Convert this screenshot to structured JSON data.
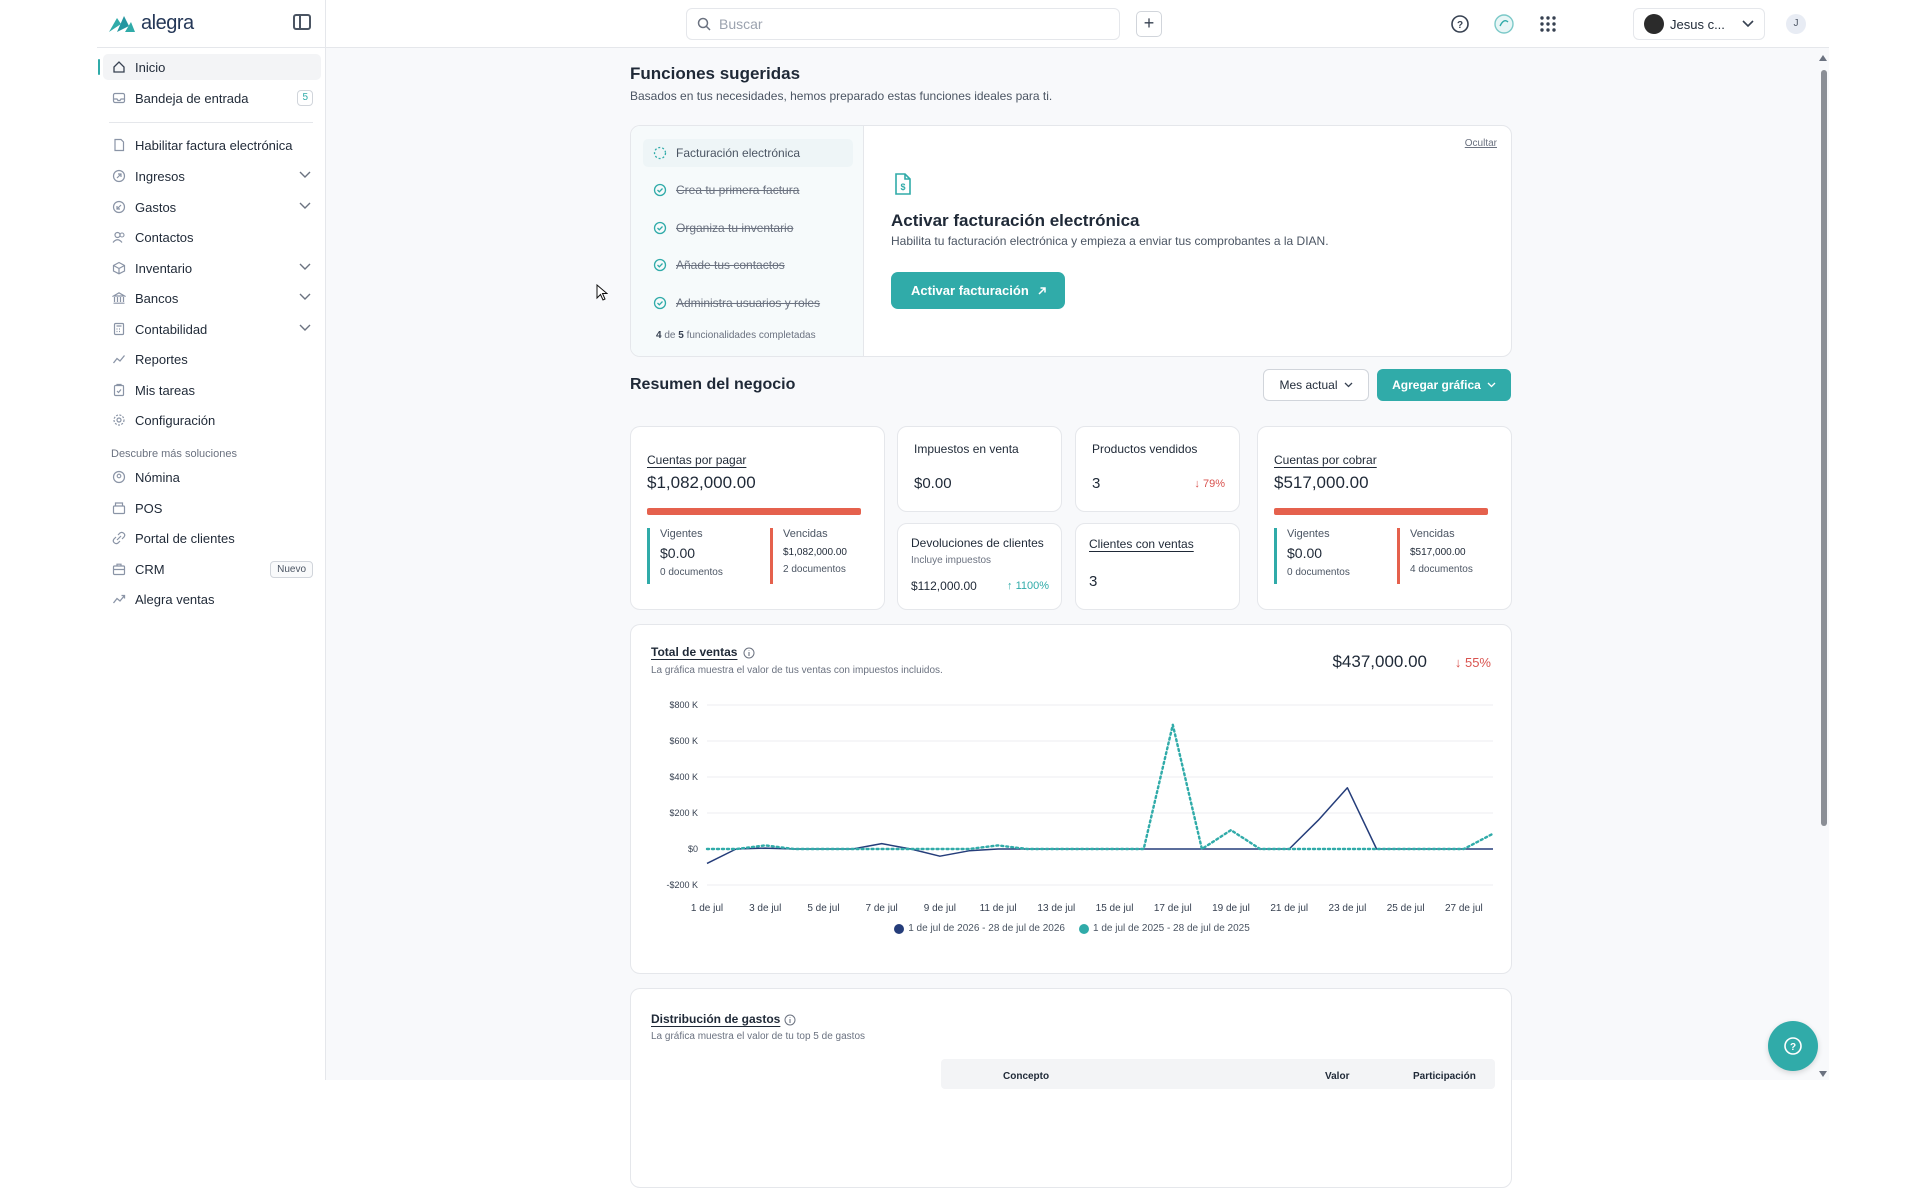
{
  "topbar": {
    "logo_text": "alegra",
    "search_placeholder": "Buscar",
    "add_label": "+",
    "user_name": "Jesus c...",
    "user_initial": "J"
  },
  "sidebar": {
    "items": [
      {
        "label": "Inicio",
        "icon": "home-icon"
      },
      {
        "label": "Bandeja de entrada",
        "icon": "inbox-icon",
        "badge": "5"
      },
      {
        "label": "Habilitar factura electrónica",
        "icon": "document-icon"
      },
      {
        "label": "Ingresos",
        "icon": "income-icon"
      },
      {
        "label": "Gastos",
        "icon": "expenses-icon"
      },
      {
        "label": "Contactos",
        "icon": "contacts-icon"
      },
      {
        "label": "Inventario",
        "icon": "box-icon"
      },
      {
        "label": "Bancos",
        "icon": "bank-icon"
      },
      {
        "label": "Contabilidad",
        "icon": "calculator-icon"
      },
      {
        "label": "Reportes",
        "icon": "chart-line-icon"
      },
      {
        "label": "Mis tareas",
        "icon": "clipboard-icon"
      },
      {
        "label": "Configuración",
        "icon": "gear-icon"
      }
    ],
    "section_label": "Descubre más soluciones",
    "solutions": [
      {
        "label": "Nómina",
        "icon": "payroll-icon"
      },
      {
        "label": "POS",
        "icon": "pos-icon"
      },
      {
        "label": "Portal de clientes",
        "icon": "portal-icon"
      },
      {
        "label": "CRM",
        "icon": "crm-icon",
        "badge": "Nuevo"
      },
      {
        "label": "Alegra ventas",
        "icon": "sales-icon"
      }
    ]
  },
  "suggested": {
    "title": "Funciones sugeridas",
    "subtitle": "Basados en tus necesidades, hemos preparado estas funciones ideales para ti.",
    "steps": [
      {
        "label": "Facturación electrónica",
        "done": false
      },
      {
        "label": "Crea tu primera factura",
        "done": true
      },
      {
        "label": "Organiza tu inventario",
        "done": true
      },
      {
        "label": "Añade tus contactos",
        "done": true
      },
      {
        "label": "Administra usuarios y roles",
        "done": true
      }
    ],
    "progress_done": "4",
    "progress_mid": "de",
    "progress_total": "5",
    "progress_suffix": "funcionalidades completadas",
    "hide_label": "Ocultar",
    "card_title": "Activar facturación electrónica",
    "card_desc": "Habilita tu facturación electrónica y empieza a enviar tus comprobantes a la DIAN.",
    "card_button": "Activar facturación"
  },
  "summary": {
    "title": "Resumen del negocio",
    "period_button": "Mes actual",
    "add_chart_button": "Agregar gráfica",
    "payables": {
      "title": "Cuentas por pagar",
      "value": "$1,082,000.00",
      "current_label": "Vigentes",
      "current_value": "$0.00",
      "current_docs": "0 documentos",
      "overdue_label": "Vencidas",
      "overdue_value": "$1,082,000.00",
      "overdue_docs": "2 documentos"
    },
    "sales_tax": {
      "title": "Impuestos en venta",
      "value": "$0.00"
    },
    "products_sold": {
      "title": "Productos vendidos",
      "value": "3",
      "trend": "79%"
    },
    "returns": {
      "title": "Devoluciones de clientes",
      "subtitle": "Incluye impuestos",
      "value": "$112,000.00",
      "trend": "1100%"
    },
    "clients_with_sales": {
      "title": "Clientes con ventas",
      "value": "3"
    },
    "receivables": {
      "title": "Cuentas por cobrar",
      "value": "$517,000.00",
      "current_label": "Vigentes",
      "current_value": "$0.00",
      "current_docs": "0 documentos",
      "overdue_label": "Vencidas",
      "overdue_value": "$517,000.00",
      "overdue_docs": "4 documentos"
    }
  },
  "sales_chart": {
    "title": "Total de ventas",
    "subtitle": "La gráfica muestra el valor de tus ventas con impuestos incluidos.",
    "total": "$437,000.00",
    "trend": "55%"
  },
  "chart_data": {
    "type": "line",
    "x": [
      "1 de jul",
      "2 de jul",
      "3 de jul",
      "4 de jul",
      "5 de jul",
      "6 de jul",
      "7 de jul",
      "8 de jul",
      "9 de jul",
      "10 de jul",
      "11 de jul",
      "12 de jul",
      "13 de jul",
      "14 de jul",
      "15 de jul",
      "16 de jul",
      "17 de jul",
      "18 de jul",
      "19 de jul",
      "20 de jul",
      "21 de jul",
      "22 de jul",
      "23 de jul",
      "24 de jul",
      "25 de jul",
      "26 de jul",
      "27 de jul",
      "28 de jul"
    ],
    "x_tick_labels": [
      "1 de jul",
      "3 de jul",
      "5 de jul",
      "7 de jul",
      "9 de jul",
      "11 de jul",
      "13 de jul",
      "15 de jul",
      "17 de jul",
      "19 de jul",
      "21 de jul",
      "23 de jul",
      "25 de jul",
      "27 de jul"
    ],
    "y_tick_labels": [
      "$800 K",
      "$600 K",
      "$400 K",
      "$200 K",
      "$0",
      "-$200 K"
    ],
    "ylim": [
      -200,
      800
    ],
    "y_unit": "K",
    "series": [
      {
        "name": "1 de jul de 2026 - 28 de jul de 2026",
        "color": "#253d7a",
        "style": "solid",
        "values": [
          -80,
          0,
          5,
          0,
          0,
          0,
          30,
          0,
          -40,
          -10,
          0,
          0,
          0,
          0,
          0,
          0,
          0,
          0,
          0,
          0,
          0,
          160,
          340,
          0,
          0,
          0,
          0,
          0
        ]
      },
      {
        "name": "1 de jul de 2025 - 28 de jul de 2025",
        "color": "#30aba9",
        "style": "dotted",
        "values": [
          0,
          0,
          20,
          0,
          0,
          0,
          0,
          0,
          0,
          0,
          20,
          0,
          0,
          0,
          0,
          0,
          690,
          0,
          105,
          0,
          0,
          0,
          0,
          0,
          0,
          0,
          0,
          85
        ]
      }
    ],
    "legend_position": "bottom",
    "grid": true
  },
  "distribution": {
    "title": "Distribución de gastos",
    "subtitle": "La gráfica muestra el valor de tu top 5 de gastos",
    "columns": [
      "Concepto",
      "Valor",
      "Participación"
    ]
  },
  "colors": {
    "accent": "#30aba9",
    "danger": "#e5614d",
    "navy": "#253d7a"
  }
}
